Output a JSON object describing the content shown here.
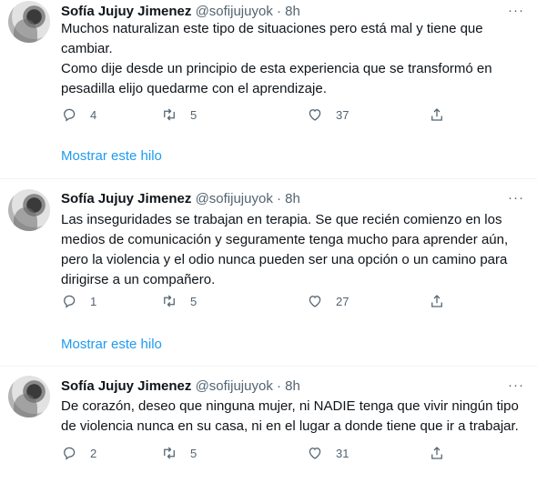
{
  "tweets": [
    {
      "name": "Sofía Jujuy Jimenez",
      "handle": "@sofijujuyok",
      "dot": "·",
      "time": "8h",
      "more": "···",
      "text": "Muchos naturalizan este tipo de situaciones pero está mal y tiene que cambiar.\nComo dije desde un principio de esta experiencia que se transformó en pesadilla elijo quedarme con el aprendizaje.",
      "replies": "4",
      "retweets": "5",
      "likes": "37",
      "show_thread": "Mostrar este hilo"
    },
    {
      "name": "Sofía Jujuy Jimenez",
      "handle": "@sofijujuyok",
      "dot": "·",
      "time": "8h",
      "more": "···",
      "text": "Las inseguridades se trabajan en terapia. Se que recién comienzo en los medios de comunicación y seguramente tenga mucho para aprender aún, pero la violencia y el odio nunca pueden ser una opción o un camino para dirigirse a un compañero.",
      "replies": "1",
      "retweets": "5",
      "likes": "27",
      "show_thread": "Mostrar este hilo"
    },
    {
      "name": "Sofía Jujuy Jimenez",
      "handle": "@sofijujuyok",
      "dot": "·",
      "time": "8h",
      "more": "···",
      "text": "De corazón, deseo que ninguna mujer, ni NADIE tenga que vivir ningún tipo de violencia nunca en su casa, ni en el lugar a donde tiene que ir a trabajar.",
      "replies": "2",
      "retweets": "5",
      "likes": "31"
    }
  ],
  "icons": {
    "reply": "reply-icon",
    "retweet": "retweet-icon",
    "like": "heart-icon",
    "share": "share-icon"
  },
  "colors": {
    "link": "#1d9bf0",
    "secondary_text": "#536471",
    "divider": "#eff3f4"
  }
}
